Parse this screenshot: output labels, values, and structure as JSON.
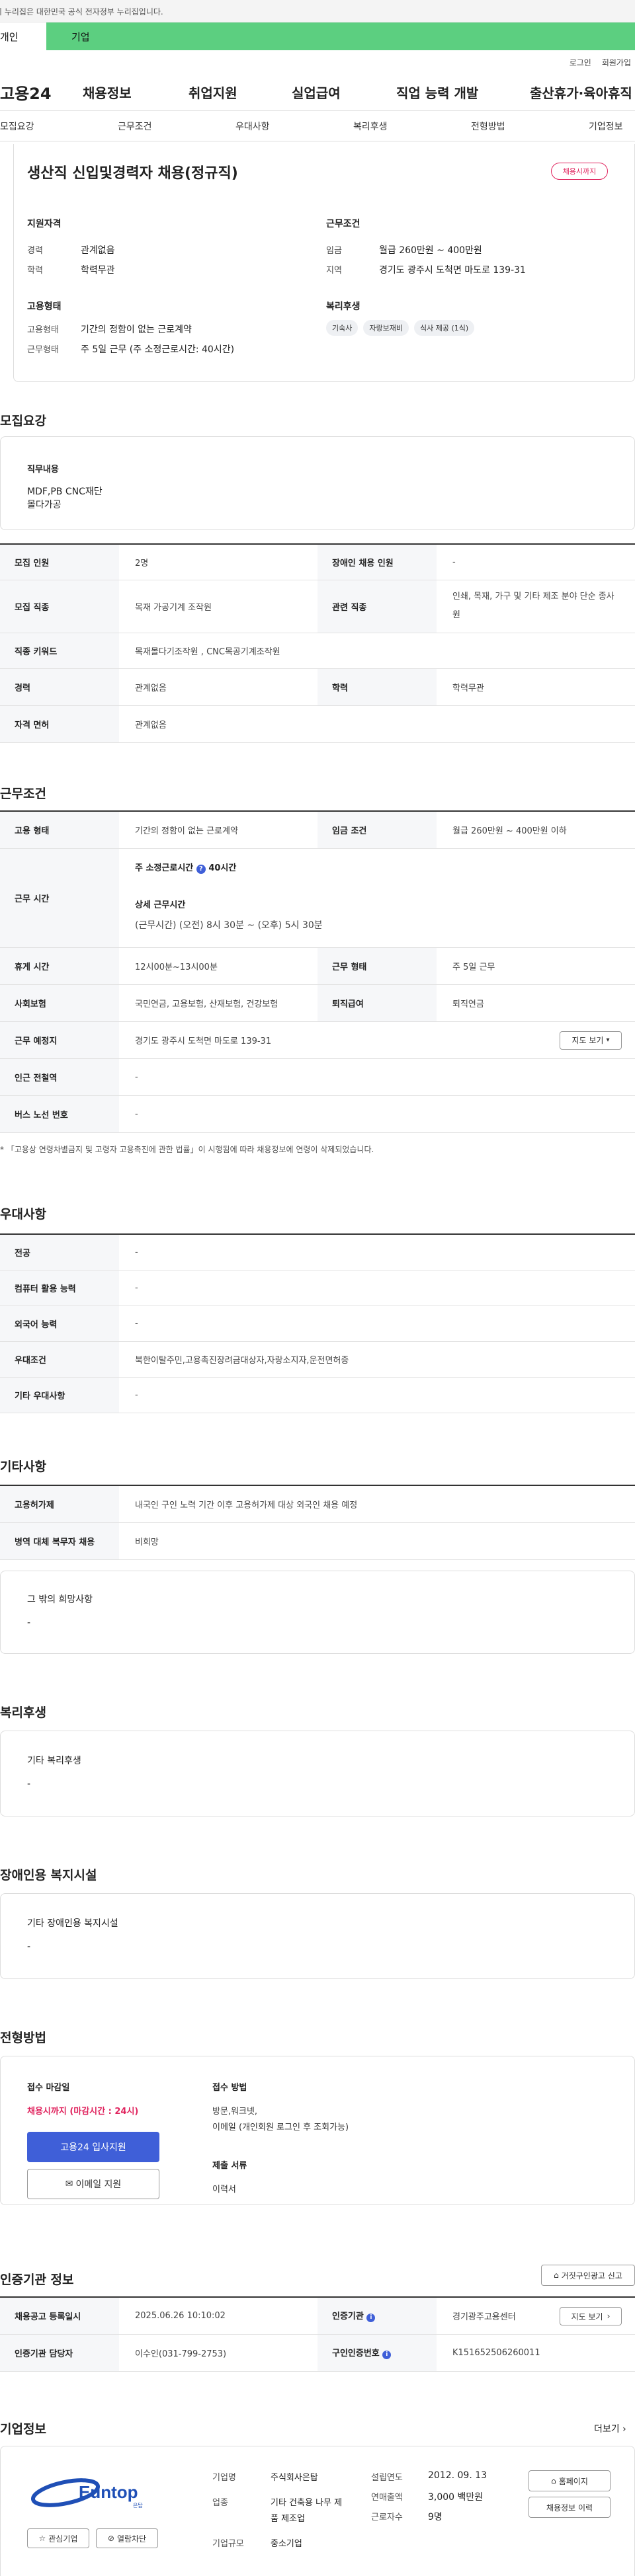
{
  "gov_bar": {
    "text": "이 누리집은 대한민국 공식 전자정부 누리집입니다."
  },
  "tabs": [
    "개인",
    "기업"
  ],
  "util": [
    "로그인",
    "회원가입"
  ],
  "gnb": {
    "logo": "고용24",
    "items": [
      "채용정보",
      "취업지원",
      "실업급여",
      "직업 능력 개발",
      "출산휴가·육아휴직"
    ]
  },
  "subnav": [
    "모집요강",
    "근무조건",
    "우대사항",
    "복리후생",
    "전형방법",
    "기업정보"
  ],
  "summary": {
    "title": "생산직 신입및경력자 채용(정규직)",
    "badge": "채용시까지",
    "qual_title": "지원자격",
    "career_label": "경력",
    "career": "관계없음",
    "edu_label": "학력",
    "edu": "학력무관",
    "emp_title": "고용형태",
    "emp_type_label": "고용형태",
    "emp_type": "기간의 정함이 없는 근로계약",
    "work_form_label": "근무형태",
    "work_form": "주 5일 근무 (주 소정근로시간: 40시간)",
    "cond_title": "근무조건",
    "wage_label": "임금",
    "wage": "월급 260만원 ~ 400만원",
    "area_label": "지역",
    "area": "경기도 광주시 도척면 마도로 139-31",
    "welfare_title": "복리후생",
    "welfare": [
      "기숙사",
      "자랑보재비",
      "식사 제공 (1식)"
    ]
  },
  "recruit": {
    "title": "모집요강",
    "duty_title": "직무내용",
    "duty": [
      "MDF,PB CNC재단",
      "몰다가공"
    ],
    "rows": [
      [
        "모집 인원",
        "2명",
        "장애인 채용 인원",
        "-"
      ],
      [
        "모집 직종",
        "목재 가공기계 조작원",
        "관련 직종",
        "인쇄, 목재, 가구 및 기타 제조 분야 단순 종사원"
      ],
      [
        "직종 키워드",
        "목재몰다기조작원 , CNC목공기계조작원"
      ],
      [
        "경력",
        "관계없음",
        "학력",
        "학력무관"
      ],
      [
        "자격 면허",
        "관계없음"
      ]
    ]
  },
  "work": {
    "title": "근무조건",
    "emp_label": "고용 형태",
    "emp": "기간의 정함이 없는 근로계약",
    "wage_label": "임금 조건",
    "wage": "월급 260만원 ~ 400만원 이하",
    "hours_label": "근무 시간",
    "hours_week_label": "주 소정근로시간",
    "hours_week": "40시간",
    "hours_detail_label": "상세 근무시간",
    "hours_detail": "(근무시간) (오전) 8시 30분 ~ (오후) 5시 30분",
    "break_label": "휴게 시간",
    "break": "12시00분~13시00분",
    "form_label": "근무 형태",
    "form": "주 5일 근무",
    "ins_label": "사회보험",
    "ins": "국민연금, 고용보험, 산재보험, 건강보험",
    "retire_label": "퇴직급여",
    "retire": "퇴직연금",
    "place_label": "근무 예정지",
    "place": "경기도 광주시 도척면 마도로 139-31",
    "map_btn": "지도 보기",
    "subway_label": "인근 전철역",
    "subway": "-",
    "bus_label": "버스 노선 번호",
    "bus": "-",
    "note": "「고용상 연령차별금지 및 고령자 고용촉진에 관한 법률」이 시행됨에 따라 채용정보에 연령이 삭제되었습니다."
  },
  "pref": {
    "title": "우대사항",
    "rows": [
      [
        "전공",
        "-"
      ],
      [
        "컴퓨터 활용 능력",
        "-"
      ],
      [
        "외국어 능력",
        "-"
      ],
      [
        "우대조건",
        "북한이탈주민,고용촉진장려금대상자,자랑소지자,운전면허증"
      ],
      [
        "기타 우대사항",
        "-"
      ]
    ]
  },
  "etc": {
    "title": "기타사항",
    "rows": [
      [
        "고용허가제",
        "내국인 구인 노력 기간 이후 고용허가제 대상 외국인 채용 예정"
      ],
      [
        "병역 대체 복무자 채용",
        "비희망"
      ]
    ],
    "other_title": "그 밖의 희망사항",
    "other": "-"
  },
  "benefit": {
    "title": "복리후생",
    "sub": "기타 복리후생",
    "val": "-"
  },
  "disabled": {
    "title": "장애인용 복지시설",
    "sub": "기타 장애인용 복지시설",
    "val": "-"
  },
  "process": {
    "title": "전형방법",
    "deadline_title": "접수 마감일",
    "deadline": "채용시까지 (마감시간 : 24시)",
    "apply_btn": "고용24 입사지원",
    "email_btn": "이메일 지원",
    "method_title": "접수 방법",
    "method": [
      "방문,워크넷,",
      "이메일 (개인회원 로그인 후 조회가능)"
    ],
    "docs_title": "제출 서류",
    "docs": "이력서"
  },
  "agency": {
    "title": "인증기관 정보",
    "report_btn": "거짓구인광고 신고",
    "rows": [
      [
        "채용공고 등록일시",
        "2025.06.26 10:10:02",
        "인증기관",
        "경기광주고용센터"
      ],
      [
        "인증기관 담당자",
        "이수인(031-799-2753)",
        "구인인증번호",
        "K151652506260011"
      ]
    ],
    "map_btn": "지도 보기"
  },
  "company": {
    "title": "기업정보",
    "more": "더보기",
    "logo": "Euntop",
    "logo_sub": "은탑",
    "interest_btn": "관심기업",
    "block_btn": "열람차단",
    "name_label": "기업명",
    "name": "주식회사은탑",
    "ind_label": "업종",
    "ind": "기타 건축용 나무 제품 제조업",
    "size_label": "기업규모",
    "size": "중소기업",
    "year_label": "설립연도",
    "year": "2012. 09. 13",
    "sales_label": "연매출액",
    "sales": "3,000 백만원",
    "emp_label": "근로자수",
    "emp": "9명",
    "home_btn": "홈페이지",
    "hist_btn": "채용정보 이력"
  },
  "colors": {
    "green": "#5ccf80",
    "blue": "#3f5fd8",
    "red": "#e0245e"
  }
}
